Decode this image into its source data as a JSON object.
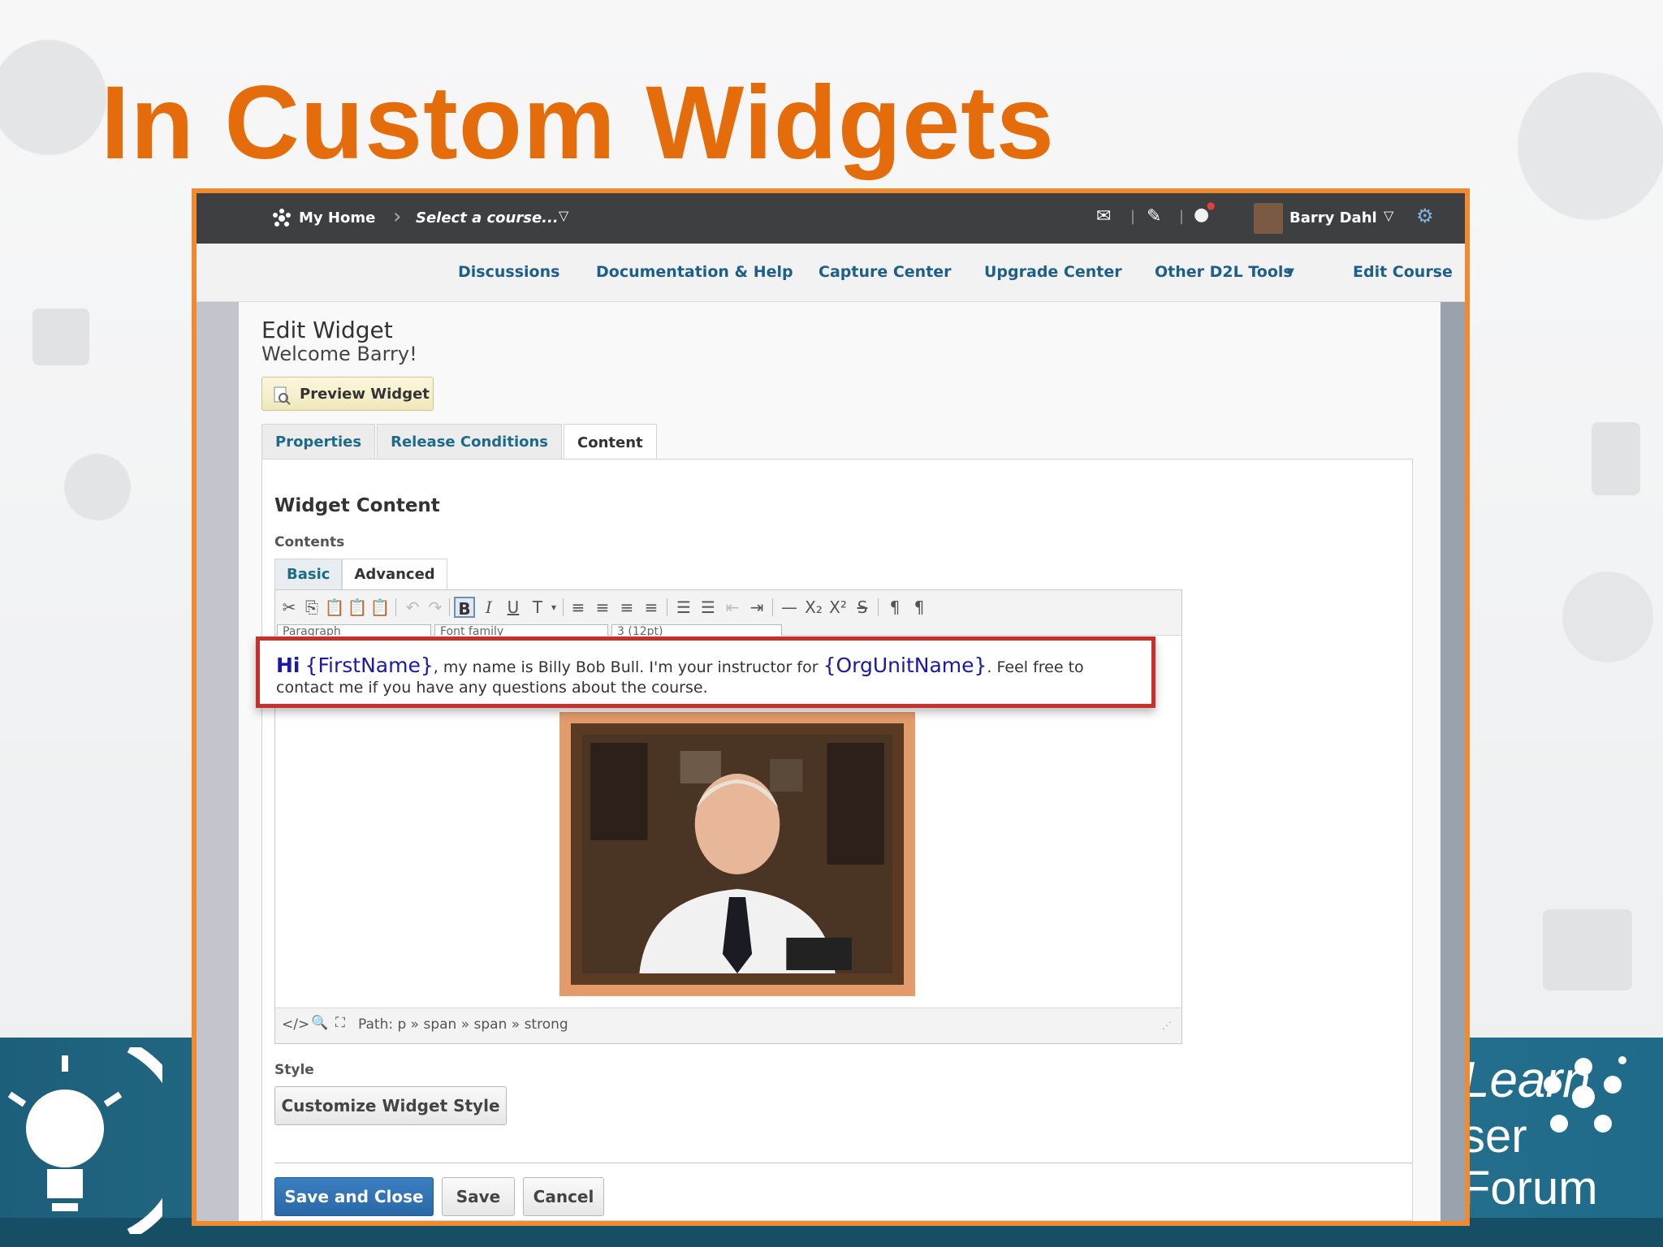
{
  "slide": {
    "title": "In Custom Widgets",
    "brand_line1": "Learn",
    "brand_line2": "ser Forum"
  },
  "topbar": {
    "home": "My Home",
    "course_select": "Select a course...",
    "user": "Barry Dahl"
  },
  "navbar": {
    "items": [
      "Discussions",
      "Documentation & Help",
      "Capture Center",
      "Upgrade Center",
      "Other D2L Tools",
      "Edit Course"
    ]
  },
  "page": {
    "title": "Edit Widget",
    "subtitle": "Welcome Barry!",
    "preview_button": "Preview Widget",
    "tabs": [
      "Properties",
      "Release Conditions",
      "Content"
    ],
    "section_title": "Widget Content",
    "contents_label": "Contents",
    "editor_tabs": [
      "Basic",
      "Advanced"
    ],
    "style_label": "Style",
    "customize_button": "Customize Widget Style"
  },
  "editor": {
    "greeting": "Hi",
    "first_name_tag": "{FirstName}",
    "text_part1": ", my name is Billy Bob Bull. I'm your instructor for",
    "org_unit_tag": "{OrgUnitName}",
    "text_part2": ". Feel free to contact me if you have any questions about the course.",
    "path": "Path: p » span » span » strong",
    "dropdowns": [
      "Paragraph",
      "Font family",
      "3 (12pt)"
    ]
  },
  "footer": {
    "save_close": "Save and Close",
    "save": "Save",
    "cancel": "Cancel"
  },
  "colors": {
    "title_orange": "#e46c0a",
    "frame_orange": "#f08a30",
    "highlight_red": "#c9302c",
    "placeholder_blue": "#1a1aa6"
  }
}
